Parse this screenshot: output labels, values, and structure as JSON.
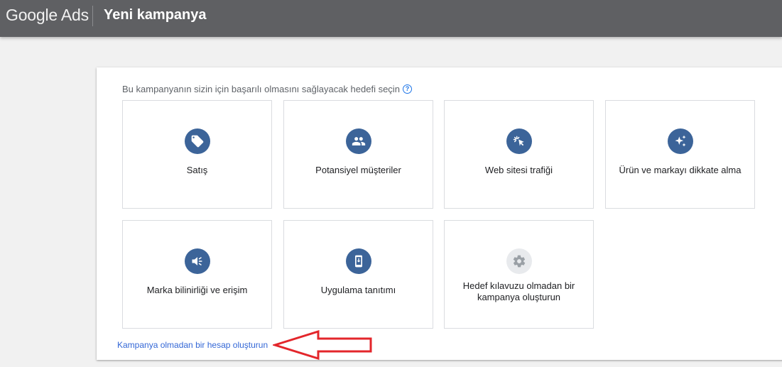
{
  "header": {
    "brand": "Google Ads",
    "title": "Yeni kampanya"
  },
  "main": {
    "instruction": "Bu kampanyanın sizin için başarılı olmasını sağlayacak hedefi seçin",
    "help_icon": "help-circle-icon",
    "goals": [
      {
        "label": "Satış",
        "icon": "tag-icon"
      },
      {
        "label": "Potansiyel müşteriler",
        "icon": "people-icon"
      },
      {
        "label": "Web sitesi trafiği",
        "icon": "cursor-click-icon"
      },
      {
        "label": "Ürün ve markayı dikkate alma",
        "icon": "sparkle-icon"
      },
      {
        "label": "Marka bilinirliği ve erişim",
        "icon": "megaphone-icon"
      },
      {
        "label": "Uygulama tanıtımı",
        "icon": "phone-download-icon"
      },
      {
        "label": "Hedef kılavuzu olmadan bir kampanya oluşturun",
        "icon": "gear-icon"
      }
    ],
    "no_campaign_link": "Kampanya olmadan bir hesap oluşturun"
  },
  "colors": {
    "header_bg": "#5f6063",
    "icon_bg": "#3c6499",
    "link": "#3367d6",
    "arrow": "#e3262b"
  }
}
